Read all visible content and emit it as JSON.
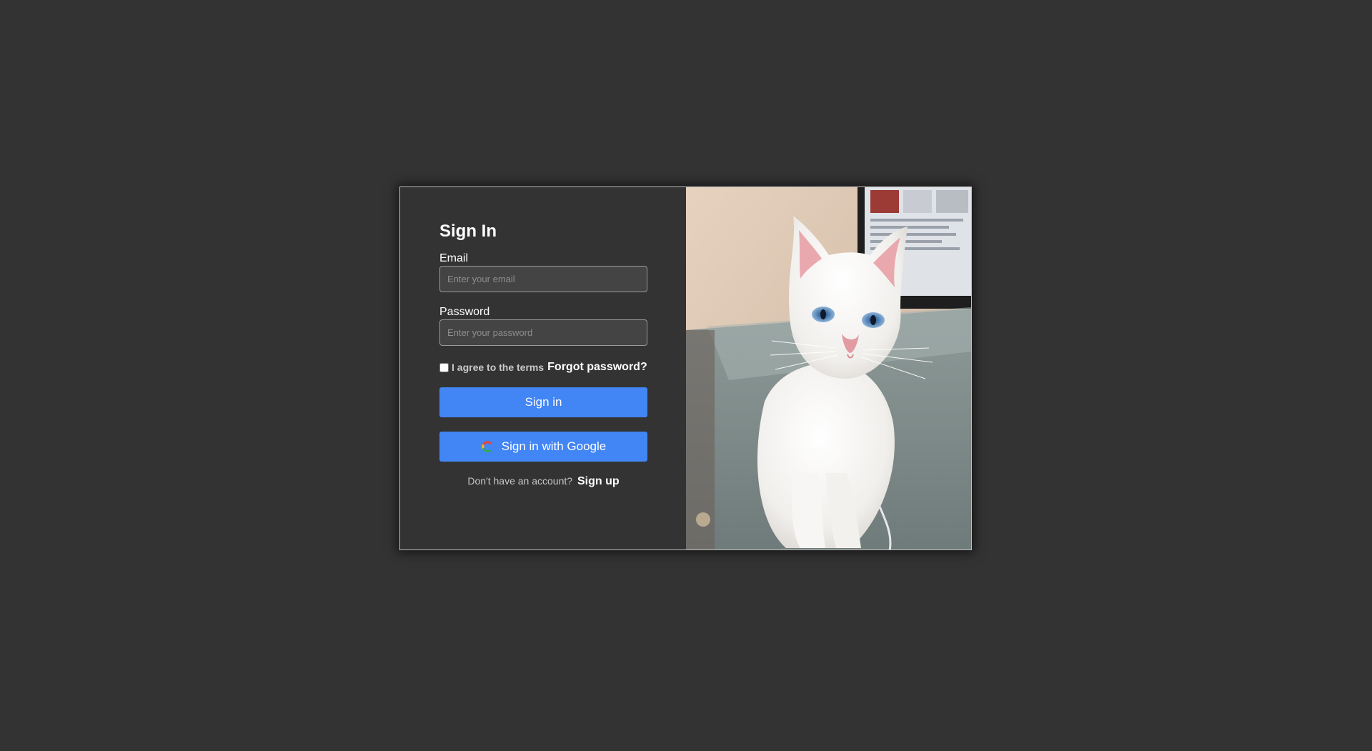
{
  "signin": {
    "title": "Sign In",
    "email": {
      "label": "Email",
      "value": "",
      "placeholder": "Enter your email"
    },
    "password": {
      "label": "Password",
      "value": "",
      "placeholder": "Enter your password"
    },
    "terms_label": "I agree to the terms",
    "terms_checked": false,
    "forgot_label": "Forgot password?",
    "signin_button": "Sign in",
    "google_button": "Sign in with Google",
    "google_icon": "google-icon",
    "signup_prompt": "Don't have an account?",
    "signup_link": "Sign up"
  },
  "colors": {
    "page_background": "#333333",
    "panel_background": "#333333",
    "button_primary": "#4285f4",
    "input_background": "#444444"
  },
  "hero_image": {
    "subject": "white-cat-photo"
  }
}
